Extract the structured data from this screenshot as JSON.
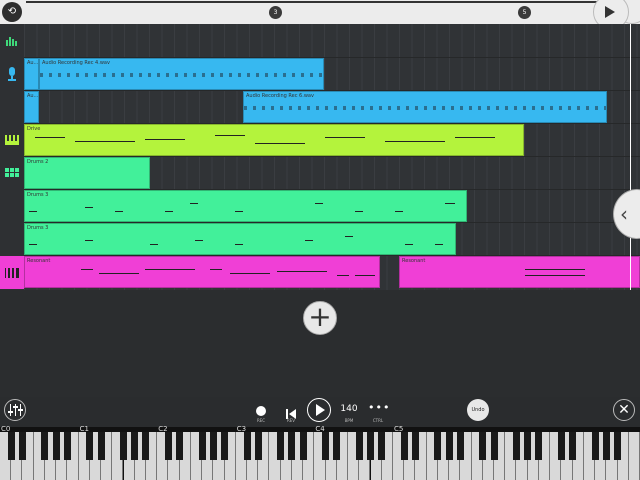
{
  "timeline": {
    "markers": [
      "3",
      "5"
    ]
  },
  "tracks": [
    {
      "icon": "bars-icon",
      "color": "#3fd97a"
    },
    {
      "icon": "microphone-icon",
      "color": "#37b8f0"
    },
    {
      "icon": "blank",
      "color": ""
    },
    {
      "icon": "piano-icon",
      "color": "#b4f33c"
    },
    {
      "icon": "drum-pads-icon",
      "color": "#42f09a"
    },
    {
      "icon": "blank",
      "color": ""
    },
    {
      "icon": "blank",
      "color": ""
    },
    {
      "icon": "keyboard-icon",
      "color": "#f03fd6"
    }
  ],
  "clips": {
    "audio_1_short": "Au...",
    "audio_1": "Audio Recording Rec 4.wav",
    "audio_2_short": "Au...",
    "audio_2": "Audio Recording Rec 6.wav",
    "drive": "Drive",
    "drums_2": "Drums 2",
    "drums_3a": "Drums 3",
    "drums_3b": "Drums 3",
    "resonant_1": "Resonant",
    "resonant_2": "Resonant"
  },
  "transport": {
    "rec_label": "REC",
    "rev_label": "REV",
    "bpm_value": "140",
    "bpm_label": "BPM",
    "ctrl_label": "CTRL",
    "undo_label": "Undo",
    "close_symbol": "✕"
  },
  "keyboard": {
    "octaves": [
      "C0",
      "C1",
      "C2",
      "C3",
      "C4",
      "C5"
    ]
  }
}
